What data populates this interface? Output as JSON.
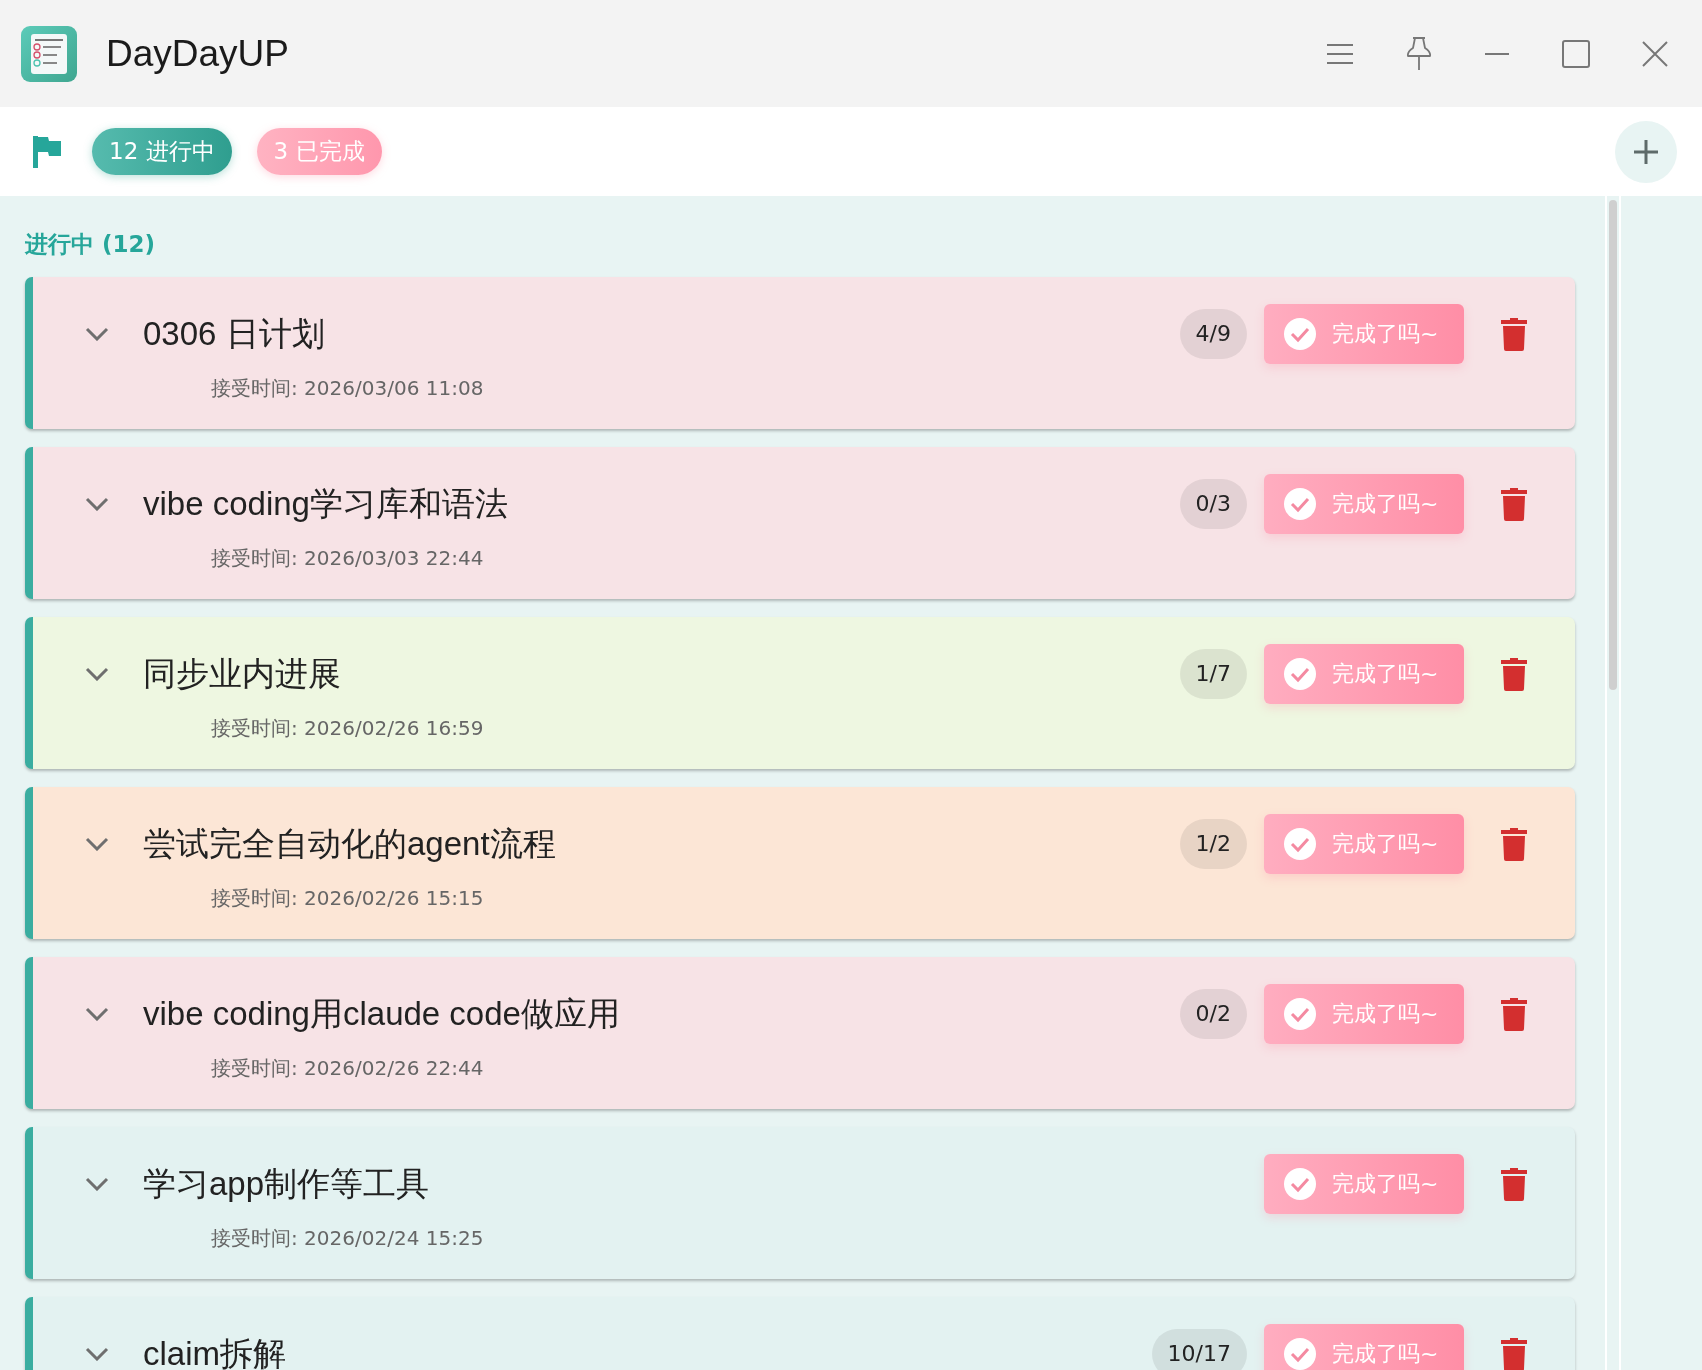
{
  "window": {
    "title": "DayDayUP"
  },
  "toolbar": {
    "chips": [
      {
        "kind": "active",
        "label": "12 进行中"
      },
      {
        "kind": "done",
        "label": "3 已完成"
      }
    ]
  },
  "section": {
    "title": "进行中 (12)"
  },
  "tasks": [
    {
      "title": "0306 日计划",
      "accepted": "接受时间: 2026/03/06 11:08",
      "count": "4/9",
      "color": "#f7e3e6",
      "button": "完成了吗~"
    },
    {
      "title": "vibe coding学习库和语法",
      "accepted": "接受时间: 2026/03/03 22:44",
      "count": "0/3",
      "color": "#f7e3e6",
      "button": "完成了吗~"
    },
    {
      "title": "同步业内进展",
      "accepted": "接受时间: 2026/02/26 16:59",
      "count": "1/7",
      "color": "#eef7e1",
      "button": "完成了吗~"
    },
    {
      "title": "尝试完全自动化的agent流程",
      "accepted": "接受时间: 2026/02/26 15:15",
      "count": "1/2",
      "color": "#fce6d6",
      "button": "完成了吗~"
    },
    {
      "title": "vibe coding用claude code做应用",
      "accepted": "接受时间: 2026/02/26 22:44",
      "count": "0/2",
      "color": "#f7e3e6",
      "button": "完成了吗~"
    },
    {
      "title": "学习app制作等工具",
      "accepted": "接受时间: 2026/02/24 15:25",
      "color": "#e3f2f1",
      "button": "完成了吗~"
    },
    {
      "title": "claim拆解",
      "count": "10/17",
      "color": "#e3f2f1",
      "button": "完成了吗~"
    }
  ]
}
